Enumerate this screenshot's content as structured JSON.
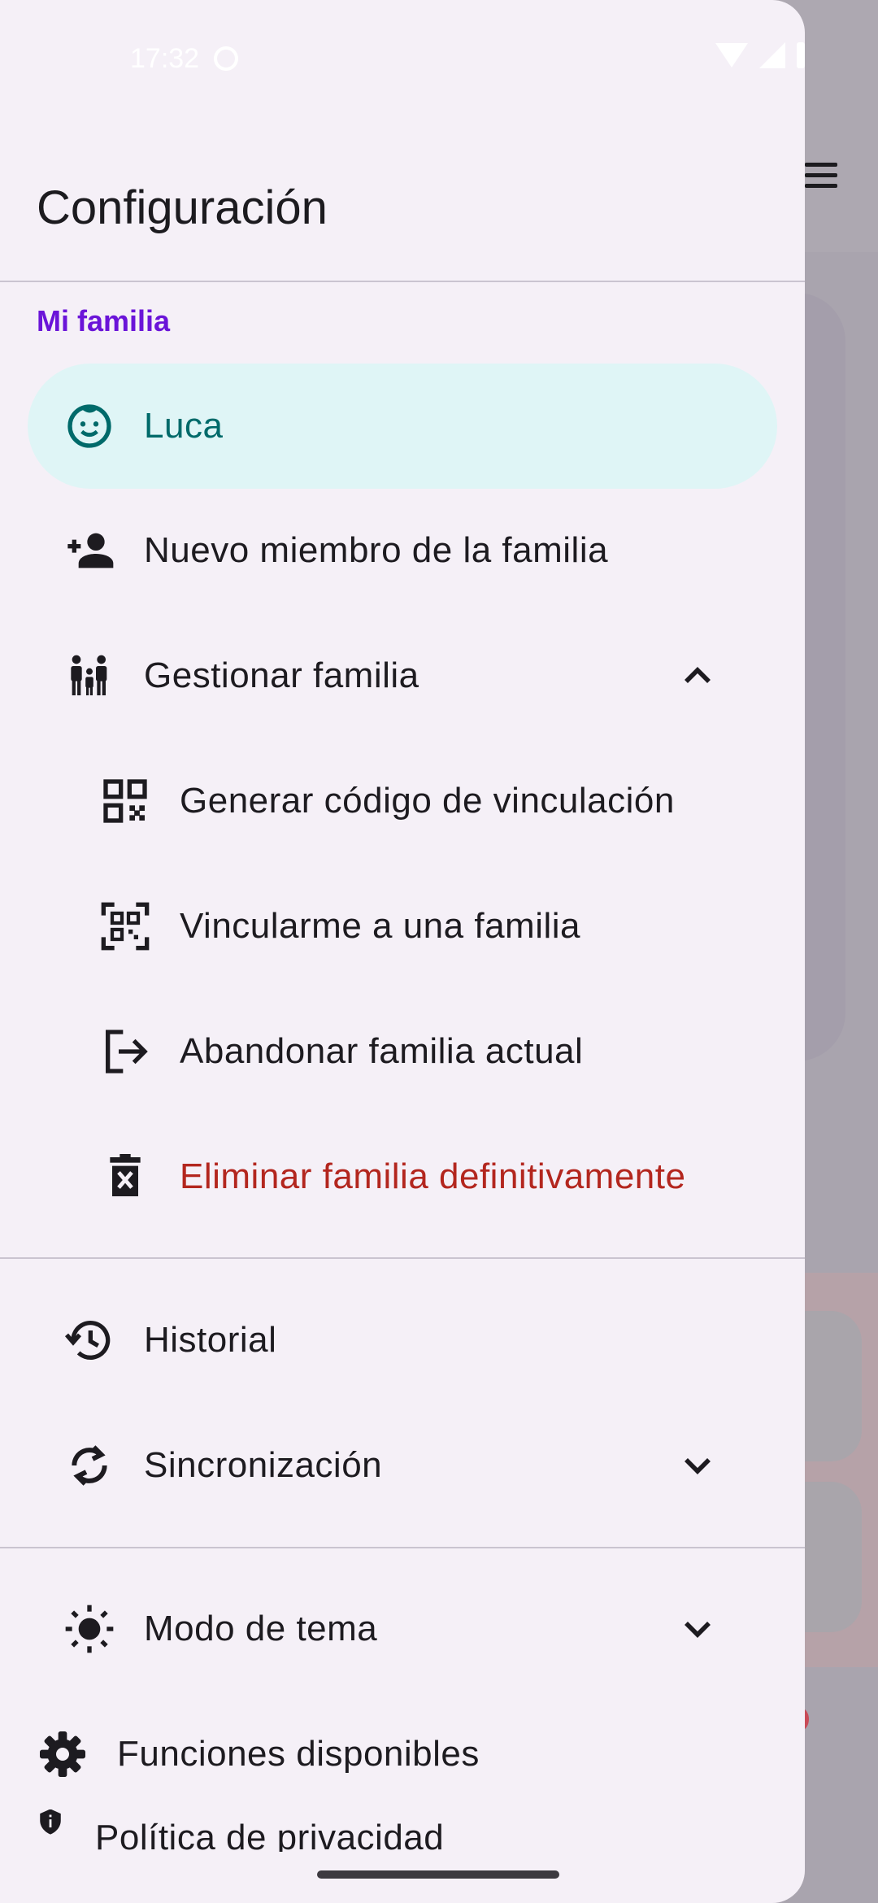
{
  "status_bar": {
    "time": "17:32"
  },
  "drawer": {
    "title": "Configuración",
    "section_label": "Mi familia",
    "members": [
      {
        "label": "Luca",
        "icon": "child-face-icon",
        "selected": true
      }
    ],
    "new_member": {
      "label": "Nuevo miembro de la familia",
      "icon": "person-add-icon"
    },
    "manage_family": {
      "label": "Gestionar familia",
      "icon": "family-icon",
      "expanded": true,
      "subitems": [
        {
          "label": "Generar código de vinculación",
          "icon": "qr-code-icon"
        },
        {
          "label": "Vincularme a una familia",
          "icon": "qr-scanner-icon"
        },
        {
          "label": "Abandonar familia actual",
          "icon": "logout-icon"
        },
        {
          "label": "Eliminar familia definitivamente",
          "icon": "delete-forever-icon",
          "danger": true
        }
      ]
    },
    "history": {
      "label": "Historial",
      "icon": "history-icon"
    },
    "sync": {
      "label": "Sincronización",
      "icon": "sync-icon",
      "expanded": false
    },
    "theme": {
      "label": "Modo de tema",
      "icon": "brightness-icon",
      "expanded": false
    },
    "features": {
      "label": "Funciones disponibles",
      "icon": "gear-icon"
    },
    "privacy": {
      "label": "Política de privacidad",
      "icon": "shield-icon"
    }
  },
  "colors": {
    "accent": "#6a14d8",
    "selected_bg": "#dff5f6",
    "selected_text": "#006a6a",
    "danger": "#b3261e",
    "drawer_bg": "#f5f0f7"
  }
}
